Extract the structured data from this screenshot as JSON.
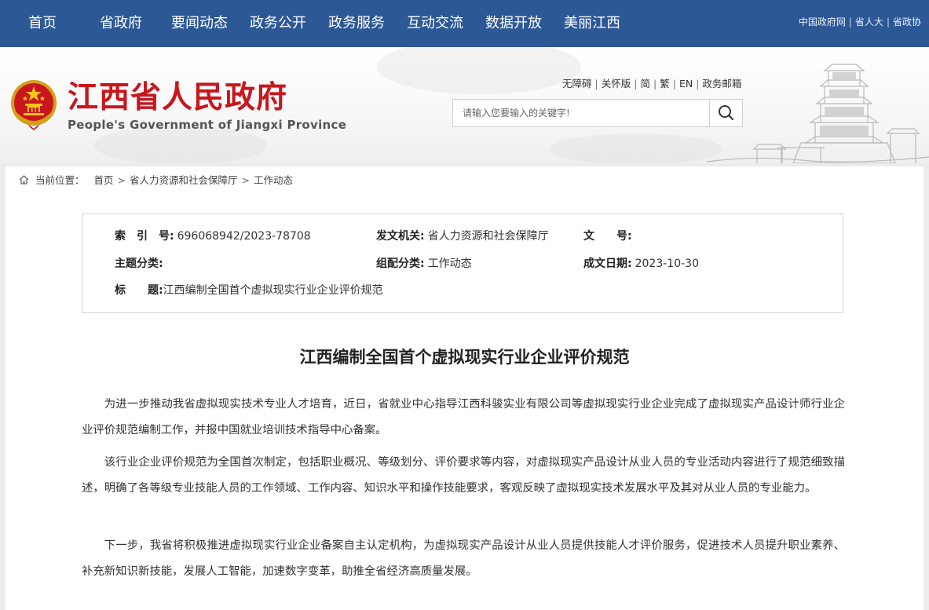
{
  "topnav": {
    "items": [
      "首页",
      "省政府",
      "要闻动态",
      "政务公开",
      "政务服务",
      "互动交流",
      "数据开放",
      "美丽江西"
    ],
    "right_links": [
      "中国政府网",
      "省人大",
      "省政协"
    ]
  },
  "header": {
    "title": "江西省人民政府",
    "subtitle": "People's Government of Jiangxi Province",
    "tool_links": [
      "无障碍",
      "关怀版",
      "简",
      "繁",
      "EN",
      "政务邮箱"
    ],
    "search_placeholder": "请输入您要输入的关键字!",
    "search_icon": "search-icon",
    "emblem_icon": "national-emblem-icon"
  },
  "breadcrumb": {
    "label": "当前位置：",
    "items": [
      "首页",
      "省人力资源和社会保障厅",
      "工作动态"
    ],
    "icon": "home-icon"
  },
  "meta": {
    "index_key": "索　引　号:",
    "index_value": "696068942/2023-78708",
    "issuer_key": "发文机关:",
    "issuer_value": "省人力资源和社会保障厅",
    "docno_key": "文　　号:",
    "docno_value": "",
    "topic_key": "主题分类:",
    "topic_value": "",
    "category_key": "组配分类:",
    "category_value": "工作动态",
    "date_key": "成文日期:",
    "date_value": "2023-10-30",
    "title_key": "标　　题:",
    "title_value": "江西编制全国首个虚拟现实行业企业评价规范"
  },
  "article": {
    "title": "江西编制全国首个虚拟现实行业企业评价规范",
    "paragraphs": [
      "为进一步推动我省虚拟现实技术专业人才培育，近日，省就业中心指导江西科骏实业有限公司等虚拟现实行业企业完成了虚拟现实产品设计师行业企业评价规范编制工作，并报中国就业培训技术指导中心备案。",
      "该行业企业评价规范为全国首次制定，包括职业概况、等级划分、评价要求等内容，对虚拟现实产品设计从业人员的专业活动内容进行了规范细致描述，明确了各等级专业技能人员的工作领域、工作内容、知识水平和操作技能要求，客观反映了虚拟现实技术发展水平及其对从业人员的专业能力。",
      "下一步，我省将积极推进虚拟现实行业企业备案自主认定机构，为虚拟现实产品设计从业人员提供技能人才评价服务，促进技术人员提升职业素养、补充新知识新技能，发展人工智能，加速数字变革，助推全省经济高质量发展。"
    ]
  },
  "colors": {
    "nav_bg": "#2d5896",
    "title_red": "#c8161d"
  }
}
